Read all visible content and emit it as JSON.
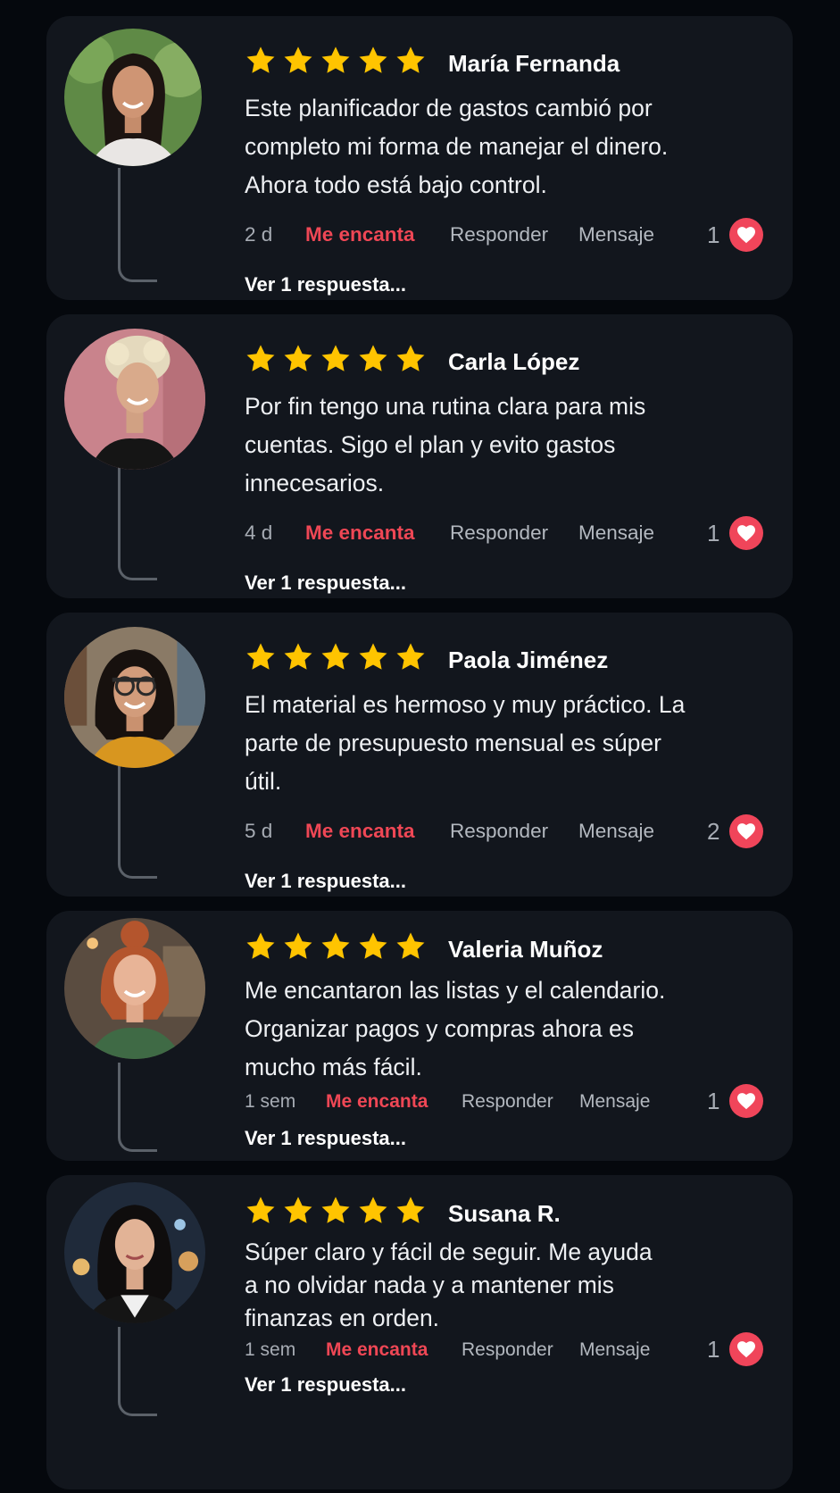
{
  "reviews": [
    {
      "name": "María Fernanda",
      "rating": 5,
      "text": "Este planificador de gastos cambió por completo mi forma de manejar el dinero. Ahora todo está bajo control.",
      "time": "2 d",
      "like_action": "Me encanta",
      "reply_action": "Responder",
      "message_action": "Mensaje",
      "likes": "1",
      "view_replies": "Ver 1 respuesta..."
    },
    {
      "name": "Carla López",
      "rating": 5,
      "text": "Por fin tengo una rutina clara para mis cuentas. Sigo el plan y evito gastos innecesarios.",
      "time": "4 d",
      "like_action": "Me encanta",
      "reply_action": "Responder",
      "message_action": "Mensaje",
      "likes": "1",
      "view_replies": "Ver 1 respuesta..."
    },
    {
      "name": "Paola Jiménez",
      "rating": 5,
      "text": "El material es hermoso y muy práctico. La parte de presupuesto mensual es súper útil.",
      "time": "5 d",
      "like_action": "Me encanta",
      "reply_action": "Responder",
      "message_action": "Mensaje",
      "likes": "2",
      "view_replies": "Ver 1 respuesta..."
    },
    {
      "name": "Valeria Muñoz",
      "rating": 5,
      "text": "Me encantaron las listas y el calendario. Organizar pagos y compras ahora es mucho más fácil.",
      "time": "1 sem",
      "like_action": "Me encanta",
      "reply_action": "Responder",
      "message_action": "Mensaje",
      "likes": "1",
      "view_replies": "Ver 1 respuesta..."
    },
    {
      "name": "Susana R.",
      "rating": 5,
      "text": "Súper claro y fácil de seguir. Me ayuda a no olvidar nada y a mantener mis finanzas en orden.",
      "time": "1 sem",
      "like_action": "Me encanta",
      "reply_action": "Responder",
      "message_action": "Mensaje",
      "likes": "1",
      "view_replies": "Ver 1 respuesta..."
    }
  ],
  "colors": {
    "background": "#05080d",
    "card": "#12161d",
    "star": "#ffc400",
    "accent_red": "#ef4755",
    "heart_badge": "#f0455a",
    "thread_line": "#5b6169"
  },
  "icons": {
    "rating": "star-icon",
    "like": "heart-icon",
    "avatar": "profile-photo"
  }
}
